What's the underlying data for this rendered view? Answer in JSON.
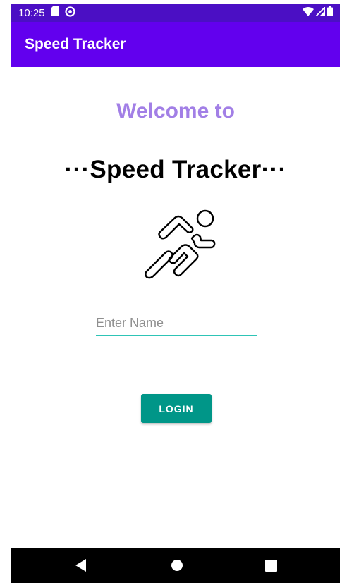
{
  "status_bar": {
    "time": "10:25",
    "left_icons": [
      "sd-card-icon",
      "sync-icon"
    ],
    "right_icons": [
      "wifi-icon",
      "cellular-signal-icon",
      "battery-icon"
    ],
    "color": "#4b0fc4"
  },
  "app_bar": {
    "title": "Speed Tracker",
    "color": "#6200ee"
  },
  "main": {
    "welcome_text": "Welcome to",
    "welcome_color": "#a27fe6",
    "app_heading": "···Speed Tracker···",
    "illustration_icon": "runner-icon",
    "name_input": {
      "value": "",
      "placeholder": "Enter Name",
      "underline_color": "#2ec4b6"
    },
    "login_button": {
      "label": "LOGIN",
      "color": "#009688"
    }
  },
  "nav_bar": {
    "buttons": [
      "back-icon",
      "home-icon",
      "recents-icon"
    ]
  }
}
